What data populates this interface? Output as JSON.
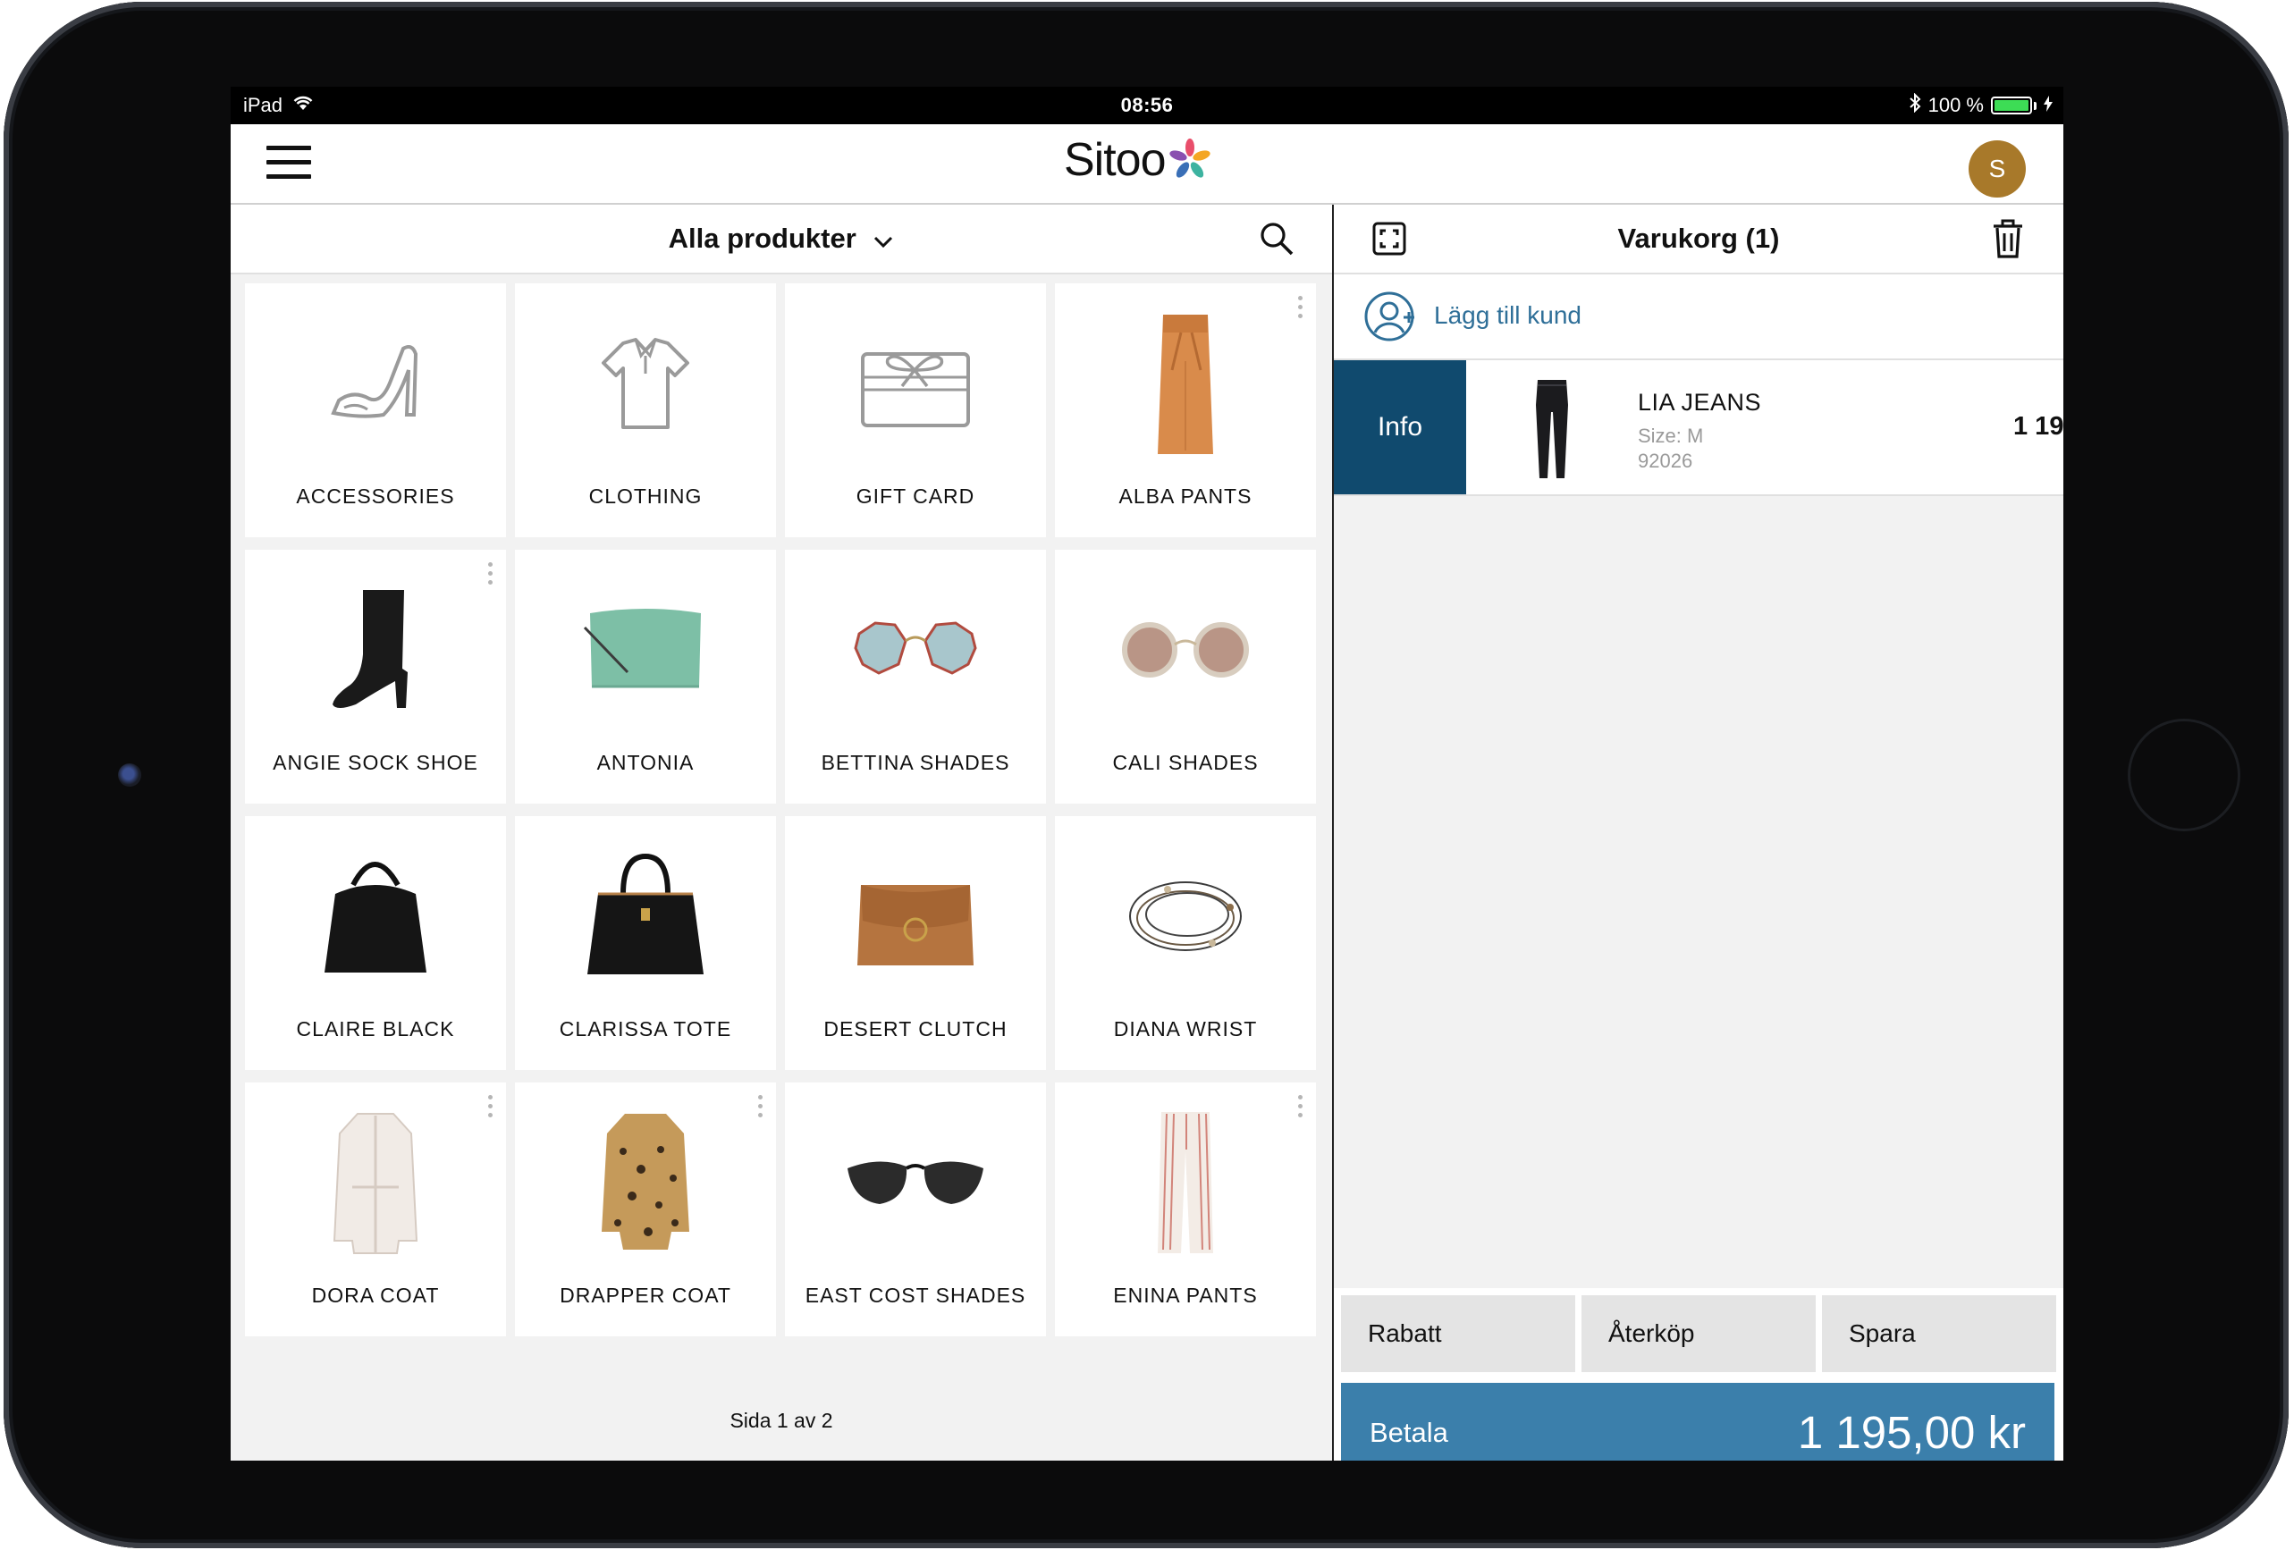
{
  "status_bar": {
    "device": "iPad",
    "time": "08:56",
    "battery": "100 %",
    "battery_level": 1.0
  },
  "header": {
    "logo": "Sitoo",
    "avatar_initial": "S"
  },
  "catalog": {
    "category": "Alla produkter",
    "tiles": [
      {
        "name": "ACCESSORIES",
        "icon": "shoe-outline-icon",
        "more": false
      },
      {
        "name": "CLOTHING",
        "icon": "shirt-outline-icon",
        "more": false
      },
      {
        "name": "GIFT CARD",
        "icon": "gift-card-icon",
        "more": false
      },
      {
        "name": "ALBA PANTS",
        "icon": "pants-photo",
        "more": true
      },
      {
        "name": "ANGIE SOCK SHOE",
        "icon": "boot-photo",
        "more": true
      },
      {
        "name": "ANTONIA",
        "icon": "clutch-photo",
        "more": false
      },
      {
        "name": "BETTINA SHADES",
        "icon": "sunglasses-photo",
        "more": false
      },
      {
        "name": "CALI SHADES",
        "icon": "round-sunglasses-photo",
        "more": false
      },
      {
        "name": "CLAIRE BLACK",
        "icon": "hobo-bag-photo",
        "more": false
      },
      {
        "name": "CLARISSA TOTE",
        "icon": "tote-photo",
        "more": false
      },
      {
        "name": "DESERT CLUTCH",
        "icon": "suede-bag-photo",
        "more": false
      },
      {
        "name": "DIANA WRIST",
        "icon": "bracelet-photo",
        "more": false
      },
      {
        "name": "DORA COAT",
        "icon": "white-coat-photo",
        "more": true
      },
      {
        "name": "DRAPPER COAT",
        "icon": "leopard-coat-photo",
        "more": true
      },
      {
        "name": "EAST COST SHADES",
        "icon": "cat-eye-sunglasses-photo",
        "more": false
      },
      {
        "name": "ENINA PANTS",
        "icon": "striped-pants-photo",
        "more": true
      }
    ],
    "pager": "Sida 1 av 2"
  },
  "cart": {
    "title": "Varukorg (1)",
    "add_customer": "Lägg till kund",
    "lines": [
      {
        "info": "Info",
        "name": "LIA JEANS",
        "size": "Size: M",
        "sku": "92026",
        "price": "1 19"
      }
    ],
    "actions": {
      "discount": "Rabatt",
      "refund": "Återköp",
      "save": "Spara"
    },
    "pay": {
      "label": "Betala",
      "amount": "1 195,00 kr"
    }
  },
  "colors": {
    "accent": "#104a6e",
    "pay": "#3b7fab",
    "link": "#2f6f98",
    "avatar": "#a8792a"
  }
}
